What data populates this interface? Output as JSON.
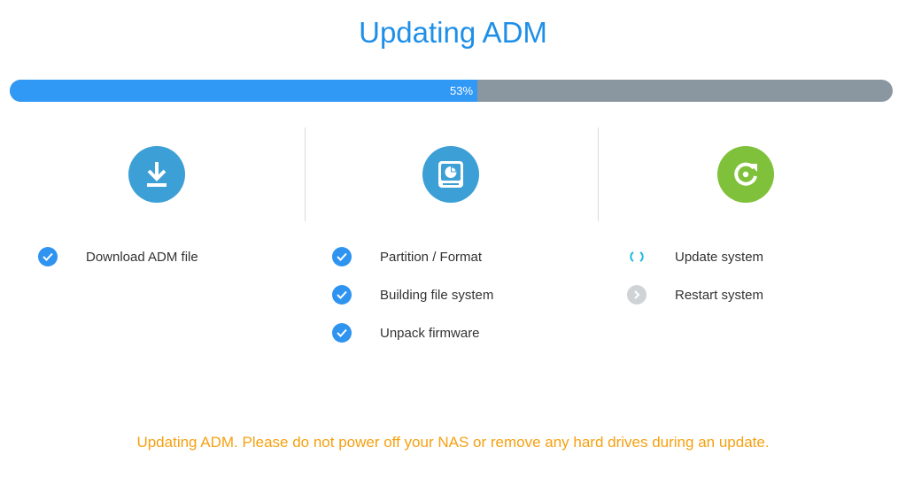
{
  "header": {
    "title": "Updating ADM"
  },
  "progress": {
    "percent": 53,
    "label": "53%"
  },
  "stages": [
    {
      "icon": "download-icon",
      "color": "#3c9fd6",
      "steps": [
        {
          "label": "Download ADM file",
          "status": "done"
        }
      ]
    },
    {
      "icon": "hard-drive-icon",
      "color": "#3c9fd6",
      "steps": [
        {
          "label": "Partition / Format",
          "status": "done"
        },
        {
          "label": "Building file system",
          "status": "done"
        },
        {
          "label": "Unpack firmware",
          "status": "done"
        }
      ]
    },
    {
      "icon": "refresh-icon",
      "color": "#7fc13a",
      "steps": [
        {
          "label": "Update system",
          "status": "in-progress"
        },
        {
          "label": "Restart system",
          "status": "pending"
        }
      ]
    }
  ],
  "warning": "Updating ADM. Please do not power off your NAS or remove any hard drives during an update.",
  "colors": {
    "accent": "#1e8fe8",
    "progress_fill": "#3098f5",
    "progress_track": "#8a97a1",
    "done": "#2f93f0",
    "in_progress": "#1fb7e0",
    "pending": "#cfd3d6",
    "warning": "#f5a011"
  }
}
